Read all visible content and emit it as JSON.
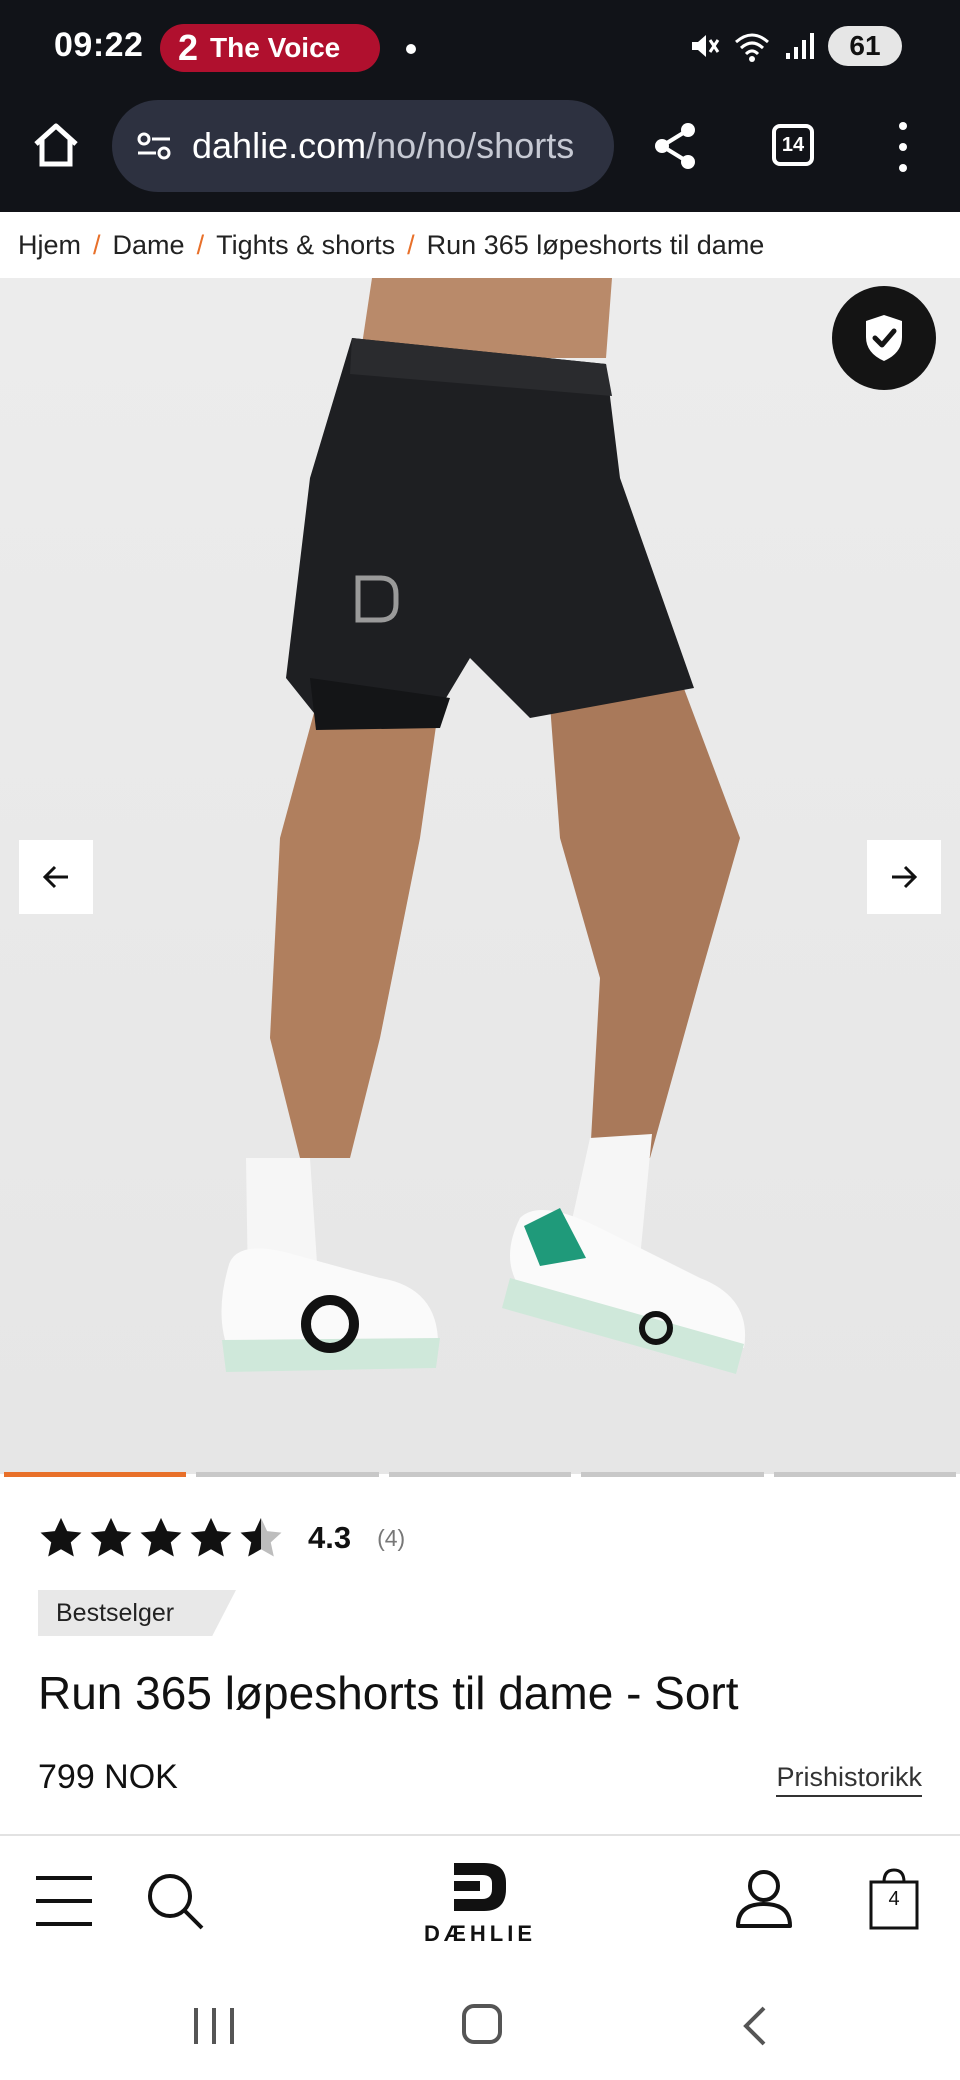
{
  "status_bar": {
    "time": "09:22",
    "notification_channel": "2",
    "notification_text": "The Voice",
    "battery": "61",
    "icons": [
      "mute-icon",
      "wifi-icon",
      "signal-icon",
      "battery-icon"
    ]
  },
  "browser": {
    "url_host": "dahlie.com",
    "url_path": "/no/no/shorts",
    "tab_count": "14",
    "icons": [
      "home-icon",
      "site-settings-icon",
      "share-icon",
      "tabs-icon",
      "more-menu-icon"
    ]
  },
  "breadcrumb": {
    "items": [
      "Hjem",
      "Dame",
      "Tights & shorts",
      "Run 365 løpeshorts til dame"
    ],
    "separator": "/"
  },
  "gallery": {
    "image_count": 5,
    "active_index": 0,
    "icons": [
      "shield-check-icon",
      "arrow-left-icon",
      "arrow-right-icon"
    ]
  },
  "product": {
    "rating_stars": 4.5,
    "rating_value": "4.3",
    "rating_count": "(4)",
    "badge": "Bestselger",
    "title": "Run 365 løpeshorts til dame - Sort",
    "price": "799 NOK",
    "price_history_link": "Prishistorikk"
  },
  "bottom_nav": {
    "logo_text": "DÆHLIE",
    "cart_count": "4",
    "icons": [
      "menu-icon",
      "search-icon",
      "logo-icon",
      "account-icon",
      "cart-icon"
    ]
  },
  "colors": {
    "accent": "#e8702a",
    "status_bar_bg": "#111318",
    "notification_pill": "#b0102e",
    "url_box": "#2d3140"
  }
}
